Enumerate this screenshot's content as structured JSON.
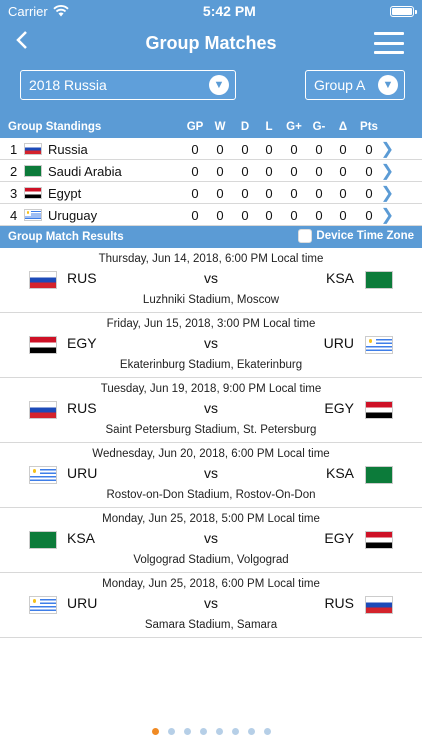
{
  "status": {
    "carrier": "Carrier",
    "time": "5:42 PM"
  },
  "nav": {
    "title": "Group Matches"
  },
  "selectors": {
    "season": "2018 Russia",
    "group": "Group A"
  },
  "standings": {
    "header": "Group Standings",
    "columns": [
      "GP",
      "W",
      "D",
      "L",
      "G+",
      "G-",
      "Δ",
      "Pts"
    ],
    "rows": [
      {
        "pos": "1",
        "team": "Russia",
        "flag": "rus",
        "vals": [
          "0",
          "0",
          "0",
          "0",
          "0",
          "0",
          "0",
          "0"
        ]
      },
      {
        "pos": "2",
        "team": "Saudi Arabia",
        "flag": "ksa",
        "vals": [
          "0",
          "0",
          "0",
          "0",
          "0",
          "0",
          "0",
          "0"
        ]
      },
      {
        "pos": "3",
        "team": "Egypt",
        "flag": "egy",
        "vals": [
          "0",
          "0",
          "0",
          "0",
          "0",
          "0",
          "0",
          "0"
        ]
      },
      {
        "pos": "4",
        "team": "Uruguay",
        "flag": "uru",
        "vals": [
          "0",
          "0",
          "0",
          "0",
          "0",
          "0",
          "0",
          "0"
        ]
      }
    ]
  },
  "results": {
    "header": "Group Match Results",
    "tz_label": "Device Time Zone",
    "vs": "vs",
    "matches": [
      {
        "date": "Thursday, Jun 14, 2018, 6:00 PM Local time",
        "home": "RUS",
        "home_flag": "rus",
        "away": "KSA",
        "away_flag": "ksa",
        "venue": "Luzhniki Stadium, Moscow"
      },
      {
        "date": "Friday, Jun 15, 2018, 3:00 PM Local time",
        "home": "EGY",
        "home_flag": "egy",
        "away": "URU",
        "away_flag": "uru",
        "venue": "Ekaterinburg Stadium, Ekaterinburg"
      },
      {
        "date": "Tuesday, Jun 19, 2018, 9:00 PM Local time",
        "home": "RUS",
        "home_flag": "rus",
        "away": "EGY",
        "away_flag": "egy",
        "venue": "Saint Petersburg Stadium, St. Petersburg"
      },
      {
        "date": "Wednesday, Jun 20, 2018, 6:00 PM Local time",
        "home": "URU",
        "home_flag": "uru",
        "away": "KSA",
        "away_flag": "ksa",
        "venue": "Rostov-on-Don Stadium, Rostov-On-Don"
      },
      {
        "date": "Monday, Jun 25, 2018, 5:00 PM Local time",
        "home": "KSA",
        "home_flag": "ksa",
        "away": "EGY",
        "away_flag": "egy",
        "venue": "Volgograd Stadium, Volgograd"
      },
      {
        "date": "Monday, Jun 25, 2018, 6:00 PM Local time",
        "home": "URU",
        "home_flag": "uru",
        "away": "RUS",
        "away_flag": "rus",
        "venue": "Samara Stadium, Samara"
      }
    ]
  },
  "pager": {
    "count": 8,
    "active": 0
  },
  "colors": {
    "accent": "#5b9bd5",
    "page_dot_active": "#f08a24"
  }
}
